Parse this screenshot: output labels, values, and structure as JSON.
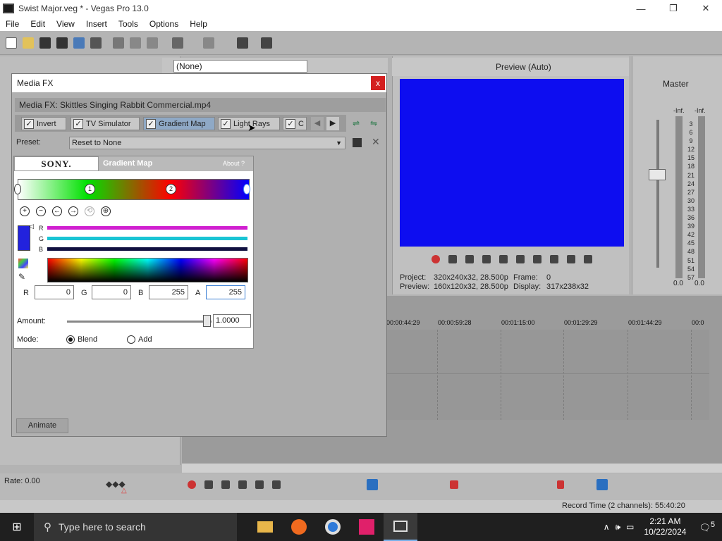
{
  "window": {
    "title": "Swist Major.veg * - Vegas Pro 13.0",
    "minimize": "—",
    "maximize": "❐",
    "close": "✕"
  },
  "menu": [
    "File",
    "Edit",
    "View",
    "Insert",
    "Tools",
    "Options",
    "Help"
  ],
  "fx_dropdown": "(None)",
  "preview": {
    "quality_label": "Preview (Auto)",
    "screen_color": "#0d0df0",
    "project_label": "Project:",
    "project_value": "320x240x32, 28.500p",
    "frame_label": "Frame:",
    "frame_value": "0",
    "preview_label": "Preview:",
    "preview_value": "160x120x32, 28.500p",
    "display_label": "Display:",
    "display_value": "317x238x32"
  },
  "mixer": {
    "master_label": "Master",
    "left_inf": "-Inf.",
    "right_inf": "-Inf.",
    "scale": [
      "3",
      "6",
      "9",
      "12",
      "15",
      "18",
      "21",
      "24",
      "27",
      "30",
      "33",
      "36",
      "39",
      "42",
      "45",
      "48",
      "51",
      "54",
      "57"
    ],
    "left_value": "0.0",
    "right_value": "0.0"
  },
  "timeline": {
    "ruler": [
      "00:00:44:29",
      "00:00:59:28",
      "00:01:15:00",
      "00:01:29:29",
      "00:01:44:29",
      "00:0"
    ]
  },
  "rate": "Rate: 0.00",
  "status_bar": "Record Time (2 channels): 55:40:20",
  "dialog": {
    "title": "Media FX",
    "close": "x",
    "header": "Media FX:  Skittles Singing Rabbit Commercial.mp4",
    "plugins": [
      "Invert",
      "TV Simulator",
      "Gradient Map",
      "Light Rays",
      "C"
    ],
    "preset_label": "Preset:",
    "preset_value": "Reset to None",
    "vendor": "SONY.",
    "plugin_name": "Gradient Map",
    "about": "About  ?",
    "stops": [
      "1",
      "2"
    ],
    "channels": {
      "r": "R",
      "g": "G",
      "b": "B"
    },
    "color": {
      "r_label": "R",
      "r": "0",
      "g_label": "G",
      "g": "0",
      "b_label": "B",
      "b": "255",
      "a_label": "A",
      "a": "255"
    },
    "amount_label": "Amount:",
    "amount_value": "1.0000",
    "amount_fraction": 1.0,
    "mode_label": "Mode:",
    "mode_options": [
      "Blend",
      "Add"
    ],
    "mode_selected": "Blend",
    "animate": "Animate"
  },
  "taskbar": {
    "search_placeholder": "Type here to search",
    "time": "2:21 AM",
    "date": "10/22/2024",
    "notifications": "5"
  }
}
